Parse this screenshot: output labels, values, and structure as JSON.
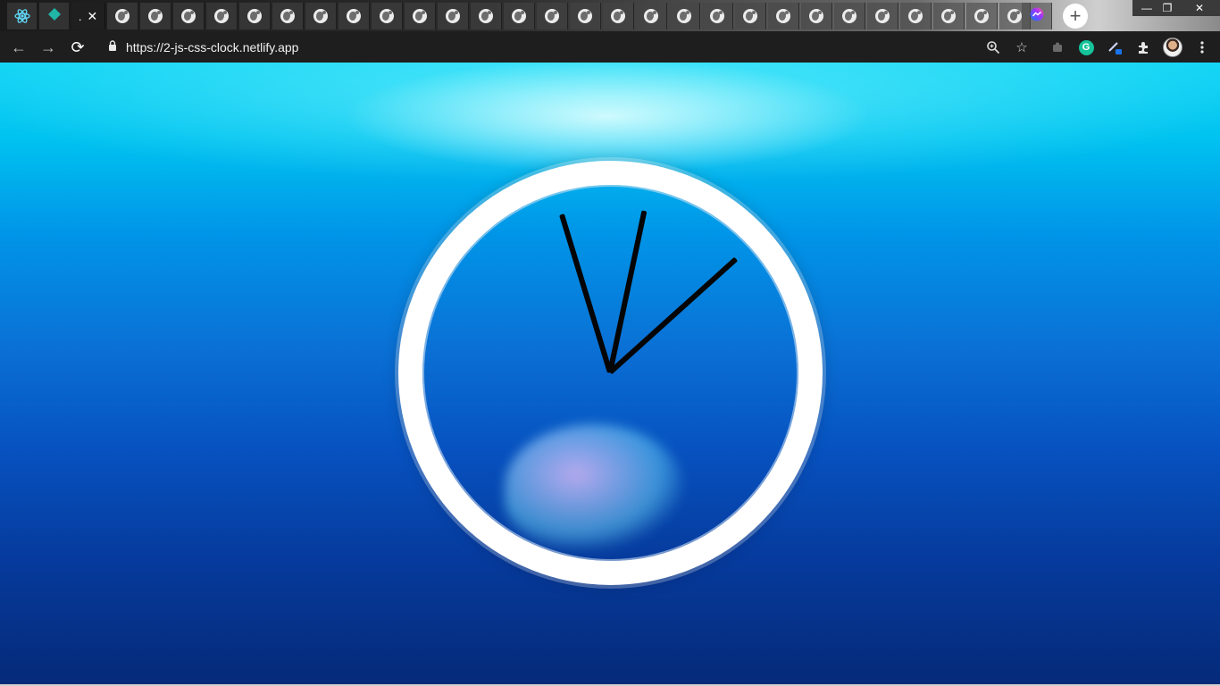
{
  "browser": {
    "tabs": {
      "active_label": ".",
      "close_glyph": "✕",
      "pinned": [
        "react-icon",
        "teal-diamond-icon"
      ],
      "inactive_count": 28
    },
    "new_tab_glyph": "+",
    "window_controls": [
      "—",
      "❐",
      "✕"
    ],
    "nav": {
      "back": "←",
      "forward": "→",
      "reload": "⟳"
    },
    "address": {
      "url": "https://2-js-css-clock.netlify.app"
    },
    "toolbar_icons": [
      "zoom-icon",
      "star-icon",
      "puzzle-extension-icon",
      "grammarly-icon",
      "pen-icon",
      "extensions-icon",
      "avatar",
      "menu-icon"
    ],
    "grammarly_letter": "G"
  },
  "clock": {
    "hour_hand_angle_deg": 12,
    "minute_hand_angle_deg": 48,
    "second_hand_angle_deg": -17,
    "colors": {
      "face_border": "#ffffff",
      "hands": "#050505"
    }
  }
}
